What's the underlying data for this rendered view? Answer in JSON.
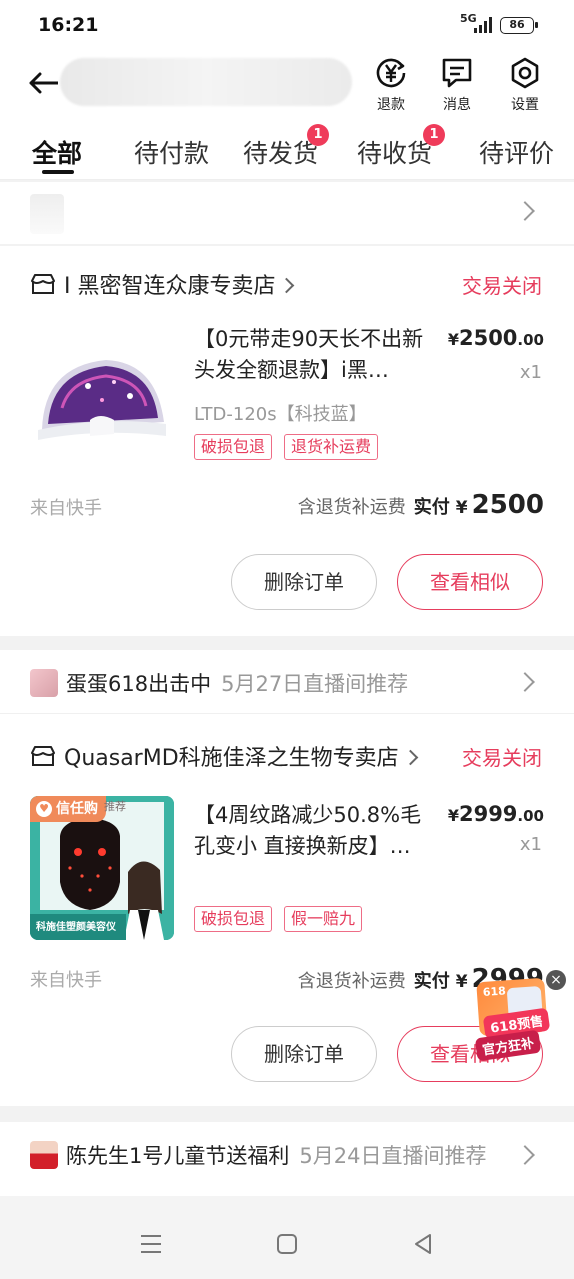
{
  "status_bar": {
    "time": "16:21",
    "network": "5G",
    "battery": "86"
  },
  "top_actions": [
    {
      "label": "退款",
      "icon": "refund-yen-icon"
    },
    {
      "label": "消息",
      "icon": "message-icon"
    },
    {
      "label": "设置",
      "icon": "settings-icon"
    }
  ],
  "tabs": [
    {
      "label": "全部",
      "active": true
    },
    {
      "label": "待付款"
    },
    {
      "label": "待发货",
      "badge": "1"
    },
    {
      "label": "待收货",
      "badge": "1"
    },
    {
      "label": "待评价"
    }
  ],
  "orders": [
    {
      "shop": "I 黑密智连众康专卖店",
      "status": "交易关闭",
      "title": "【0元带走90天长不出新头发全额退款】i黑…",
      "price_int": "2500",
      "price_dec": ".00",
      "currency": "¥",
      "qty": "x1",
      "sku": "LTD-120s【科技蓝】",
      "tags": [
        "破损包退",
        "退货补运费"
      ],
      "source": "来自快手",
      "shipping_note": "含退货补运费",
      "paid_label": "实付",
      "paid_total": "2500",
      "buttons": [
        "删除订单",
        "查看相似"
      ]
    },
    {
      "recommend_name": "蛋蛋618出击中",
      "recommend_date": "5月27日直播间推荐",
      "shop": "QuasarMD科施佳泽之生物专卖店",
      "status": "交易关闭",
      "title": "【4周纹路减少50.8%毛孔变小 直接换新皮】…",
      "price_int": "2999",
      "price_dec": ".00",
      "currency": "¥",
      "qty": "x1",
      "tags": [
        "破损包退",
        "假一赔九"
      ],
      "img_badge": "信任购",
      "img_caption": "科施佳塑颜美容仪",
      "img_corner": "推荐",
      "source": "来自快手",
      "shipping_note": "含退货补运费",
      "paid_label": "实付",
      "paid_total": "2999",
      "buttons": [
        "删除订单",
        "查看相似"
      ]
    }
  ],
  "third_recommend": {
    "name": "陈先生1号儿童节送福利",
    "date": "5月24日直播间推荐"
  },
  "float_promo": {
    "top": "618预售",
    "bottom": "官方狂补",
    "mini": "618"
  }
}
